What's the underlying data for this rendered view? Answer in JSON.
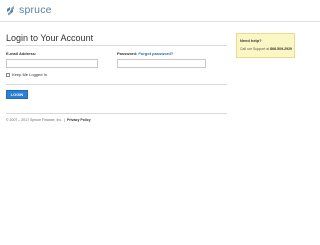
{
  "brand": {
    "name": "spruce",
    "color": "#5b7f9e"
  },
  "page": {
    "title": "Login to Your Account"
  },
  "form": {
    "email_label": "E-mail Address:",
    "email_value": "",
    "password_label": "Password:",
    "forgot_link": "Forgot password?",
    "password_value": "",
    "remember_label": "Keep Me Logged In",
    "remember_checked": false,
    "login_button": "LOGIN",
    "button_color": "#2b7fd4"
  },
  "help": {
    "title": "Need help?",
    "text_prefix": "Call our Support at",
    "phone": "866-509-2929",
    "background": "#fbf6c3"
  },
  "footer": {
    "copyright": "© 2007 – 2017 Spruce Finance, Inc.",
    "separator": "|",
    "privacy_link": "Privacy Policy"
  }
}
